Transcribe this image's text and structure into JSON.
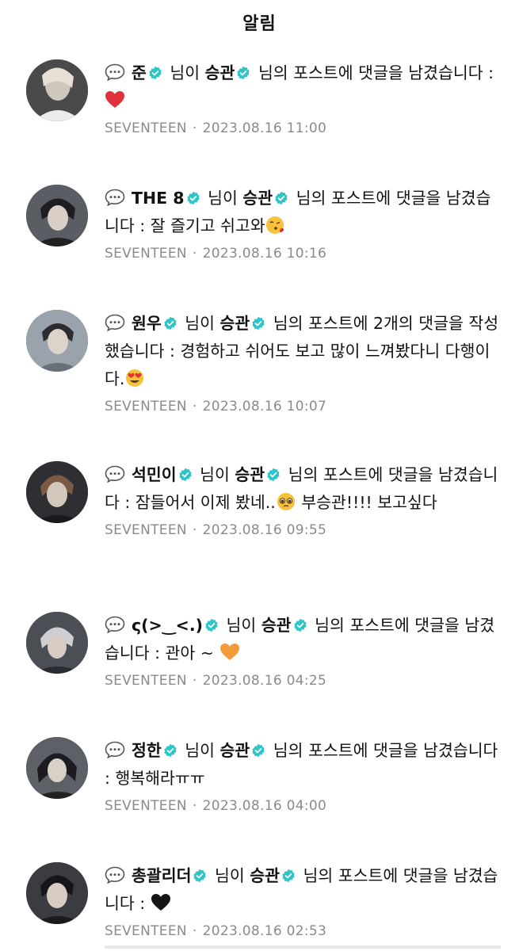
{
  "header": {
    "title": "알림"
  },
  "common": {
    "target_name": "승관",
    "group": "SEVENTEEN",
    "mid_text": "님이",
    "post_text": "님의 포스트에"
  },
  "notifications": [
    {
      "author": "준",
      "line": "댓글을 남겼습니다 :",
      "comment": "",
      "reaction": "red-heart",
      "timestamp": "2023.08.16 11:00",
      "avatar": "avatar-jun"
    },
    {
      "author": "THE 8",
      "line": "댓글을 남겼습니다 :",
      "comment": "잘 즐기고 쉬고와",
      "reaction": "kissing-face",
      "timestamp": "2023.08.16 10:16",
      "avatar": "avatar-the8"
    },
    {
      "author": "원우",
      "line": "2개의 댓글을 작성했습니다 :",
      "comment": "경험하고 쉬어도 보고 많이 느껴봤다니 다행이다.",
      "reaction": "heart-eyes",
      "timestamp": "2023.08.16 10:07",
      "avatar": "avatar-wonwoo"
    },
    {
      "author": "석민이",
      "line": "댓글을 남겼습니다 :",
      "comment": "잠들어서 이제 봤네..",
      "comment_after": "부승관!!!! 보고싶다",
      "reaction": "pleading-face",
      "timestamp": "2023.08.16 09:55",
      "avatar": "avatar-seokmin"
    },
    {
      "author": "ς(>‿<.)",
      "line": "댓글을 남겼습니다 :",
      "comment": "관아 ~",
      "reaction": "orange-heart",
      "timestamp": "2023.08.16 04:25",
      "avatar": "avatar-hoshi"
    },
    {
      "author": "정한",
      "line": "댓글을 남겼습니다 :",
      "comment": "행복해라ㅠㅠ",
      "reaction": "",
      "timestamp": "2023.08.16 04:00",
      "avatar": "avatar-jeonghan"
    },
    {
      "author": "총괄리더",
      "line": "댓글을 남겼습니다 :",
      "comment": "",
      "reaction": "black-heart",
      "timestamp": "2023.08.16 02:53",
      "avatar": "avatar-scoups"
    }
  ],
  "colors": {
    "badge": "#2ec4c8",
    "meta": "#8a8a8a",
    "text": "#111111"
  }
}
